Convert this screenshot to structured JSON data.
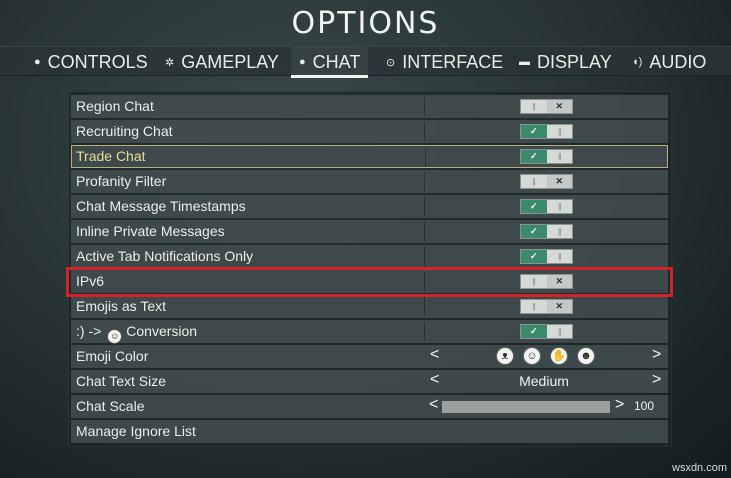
{
  "title": "OPTIONS",
  "tabs": [
    {
      "label": "CONTROLS",
      "icon": "mouse-icon",
      "glyph": "●"
    },
    {
      "label": "GAMEPLAY",
      "icon": "gear-icon",
      "glyph": "✲"
    },
    {
      "label": "CHAT",
      "icon": "chat-bubble-icon",
      "glyph": "●",
      "active": true
    },
    {
      "label": "INTERFACE",
      "icon": "interface-icon",
      "glyph": "⊙"
    },
    {
      "label": "DISPLAY",
      "icon": "monitor-icon",
      "glyph": "▬"
    },
    {
      "label": "AUDIO",
      "icon": "speaker-icon",
      "glyph": "◖)"
    }
  ],
  "settings": {
    "region_chat": {
      "label": "Region Chat",
      "value": "off"
    },
    "recruiting_chat": {
      "label": "Recruiting Chat",
      "value": "on"
    },
    "trade_chat": {
      "label": "Trade Chat",
      "value": "on"
    },
    "profanity_filter": {
      "label": "Profanity Filter",
      "value": "off"
    },
    "timestamps": {
      "label": "Chat Message Timestamps",
      "value": "on"
    },
    "inline_private": {
      "label": "Inline Private Messages",
      "value": "on"
    },
    "active_tab_notifications": {
      "label": "Active Tab Notifications Only",
      "value": "on"
    },
    "ipv6": {
      "label": "IPv6",
      "value": "off"
    },
    "emojis_as_text": {
      "label": "Emojis as Text",
      "value": "off"
    },
    "smiley_conversion": {
      "label_prefix": ":) ->",
      "label_suffix": "Conversion",
      "value": "on"
    },
    "emoji_color": {
      "label": "Emoji Color",
      "options": [
        "demon-emoji",
        "smile-emoji",
        "wave-emoji",
        "devil-emoji"
      ]
    },
    "chat_text_size": {
      "label": "Chat Text Size",
      "value": "Medium"
    },
    "chat_scale": {
      "label": "Chat Scale",
      "value": "100",
      "fraction": 1.0
    },
    "manage_ignore": {
      "label": "Manage Ignore List"
    }
  },
  "toggle_glyphs": {
    "check": "✓",
    "cross": "✕",
    "bars": "||"
  },
  "arrows": {
    "left": "<",
    "right": ">"
  },
  "colors": {
    "toggle_on": "#3c8a6c",
    "focus_border": "#b8b27a",
    "highlight": "#d6202a"
  },
  "watermark": "wsxdn.com"
}
